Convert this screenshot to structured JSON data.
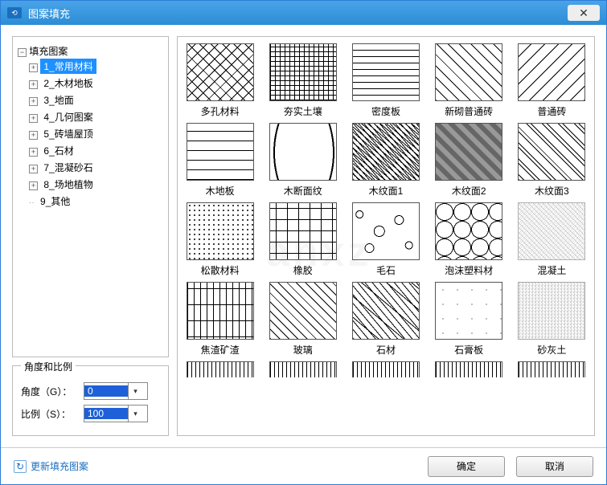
{
  "window": {
    "title": "图案填充"
  },
  "tree": {
    "root": "填充图案",
    "items": [
      "1_常用材料",
      "2_木材地板",
      "3_地面",
      "4_几何图案",
      "5_砖墙屋顶",
      "6_石材",
      "7_混凝砂石",
      "8_场地植物",
      "9_其他"
    ],
    "selected_index": 0
  },
  "angle_panel": {
    "legend": "角度和比例",
    "angle_label": "角度（G）：",
    "scale_label": "比例（S）：",
    "angle_value": "0",
    "scale_value": "100"
  },
  "patterns": {
    "row1": [
      "多孔材料",
      "夯实土壤",
      "密度板",
      "新砌普通砖",
      "普通砖"
    ],
    "row2": [
      "木地板",
      "木断面纹",
      "木纹面1",
      "木纹面2",
      "木纹面3"
    ],
    "row3": [
      "松散材料",
      "橡胶",
      "毛石",
      "泡沫塑料材",
      "混凝土"
    ],
    "row4": [
      "焦渣矿渣",
      "玻璃",
      "石材",
      "石膏板",
      "砂灰土"
    ]
  },
  "footer": {
    "refresh": "更新填充图案",
    "ok": "确定",
    "cancel": "取消"
  }
}
